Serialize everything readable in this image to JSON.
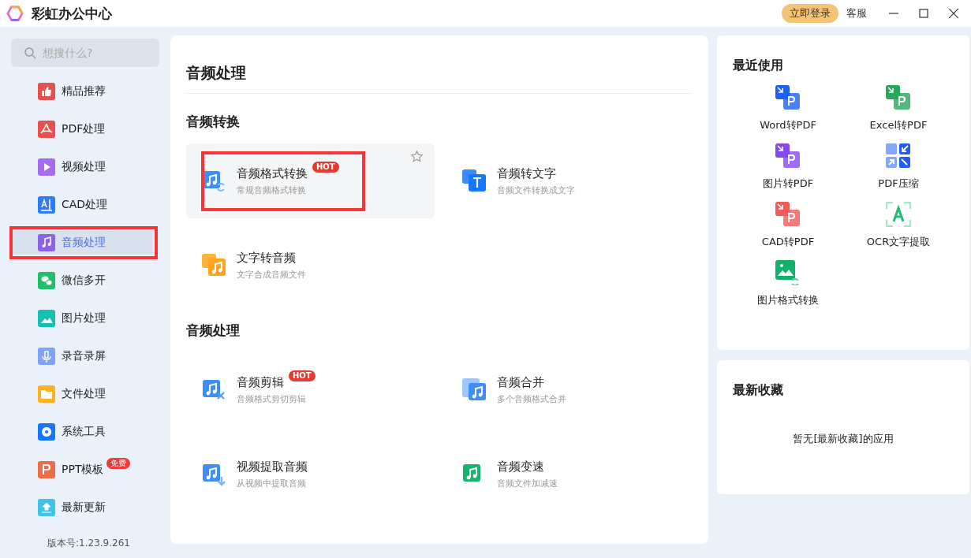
{
  "app": {
    "title": "彩虹办公中心",
    "login_button": "立即登录",
    "support_link": "客服"
  },
  "search": {
    "placeholder": "想搜什么?"
  },
  "sidebar": {
    "items": [
      {
        "label": "精品推荐",
        "kind": "thumb",
        "color": "#e8504d",
        "selected": false,
        "highlighted": false
      },
      {
        "label": "PDF处理",
        "kind": "pdf",
        "color": "#e8504d",
        "selected": false,
        "highlighted": false
      },
      {
        "label": "视频处理",
        "kind": "play",
        "color": "#a56cf0",
        "selected": false,
        "highlighted": false
      },
      {
        "label": "CAD处理",
        "kind": "cad",
        "color": "#2f7df6",
        "selected": false,
        "highlighted": false
      },
      {
        "label": "音频处理",
        "kind": "music",
        "color": "#8a63e8",
        "selected": true,
        "highlighted": true
      },
      {
        "label": "微信多开",
        "kind": "chat",
        "color": "#1fbf6b",
        "selected": false,
        "highlighted": false
      },
      {
        "label": "图片处理",
        "kind": "image",
        "color": "#16bfb3",
        "selected": false,
        "highlighted": false
      },
      {
        "label": "录音录屏",
        "kind": "mic",
        "color": "#7ea2f5",
        "selected": false,
        "highlighted": false
      },
      {
        "label": "文件处理",
        "kind": "folder",
        "color": "#ffb01f",
        "selected": false,
        "highlighted": false
      },
      {
        "label": "系统工具",
        "kind": "gear",
        "color": "#1677ff",
        "selected": false,
        "highlighted": false
      },
      {
        "label": "PPT模板",
        "kind": "ppt",
        "color": "#ef6c4a",
        "selected": false,
        "highlighted": false,
        "badge": "免费"
      },
      {
        "label": "最新更新",
        "kind": "upload",
        "color": "#3fc3e8",
        "selected": false,
        "highlighted": false
      }
    ],
    "version": "版本号:1.23.9.261"
  },
  "main": {
    "title": "音频处理",
    "sections": [
      {
        "title": "音频转换",
        "tools": [
          {
            "name": "音频格式转换",
            "description": "常规音频格式转换",
            "badge": "HOT",
            "kind": "convert",
            "color": "#3d8ef7",
            "hovered": true,
            "highlighted": true
          },
          {
            "name": "音频转文字",
            "description": "音频文件转换成文字",
            "kind": "text",
            "color": "#1677ff",
            "hovered": false,
            "highlighted": false
          },
          {
            "name": "文字转音频",
            "description": "文字合成音频文件",
            "kind": "stack",
            "color": "#ffa41b",
            "hovered": false,
            "highlighted": false
          }
        ]
      },
      {
        "title": "音频处理",
        "tools": [
          {
            "name": "音频剪辑",
            "description": "音频格式剪切剪辑",
            "badge": "HOT",
            "kind": "cut",
            "color": "#3d8ef7",
            "hovered": false,
            "highlighted": false
          },
          {
            "name": "音频合并",
            "description": "多个音频格式合并",
            "kind": "merge",
            "color": "#3d8ef7",
            "hovered": false,
            "highlighted": false
          },
          {
            "name": "视频提取音频",
            "description": "从视频中提取音频",
            "kind": "extract",
            "color": "#3d8ef7",
            "hovered": false,
            "highlighted": false
          },
          {
            "name": "音频变速",
            "description": "音频文件加减速",
            "kind": "speed",
            "color": "#16b46e",
            "hovered": false,
            "highlighted": false
          }
        ]
      }
    ]
  },
  "recent": {
    "title": "最近使用",
    "items": [
      {
        "label": "Word转PDF",
        "kind": "convert",
        "color": "#1e5ff5"
      },
      {
        "label": "Excel转PDF",
        "kind": "convert",
        "color": "#26a85c"
      },
      {
        "label": "图片转PDF",
        "kind": "convert",
        "color": "#8649f0"
      },
      {
        "label": "PDF压缩",
        "kind": "compress",
        "color": "#1e5ff5"
      },
      {
        "label": "CAD转PDF",
        "kind": "convert",
        "color": "#f25a5a"
      },
      {
        "label": "OCR文字提取",
        "kind": "ocr",
        "color": "#22bb7a"
      },
      {
        "label": "图片格式转换",
        "kind": "image",
        "color": "#12b06b"
      }
    ]
  },
  "favorites": {
    "title": "最新收藏",
    "empty_text": "暂无[最新收藏]的应用"
  }
}
